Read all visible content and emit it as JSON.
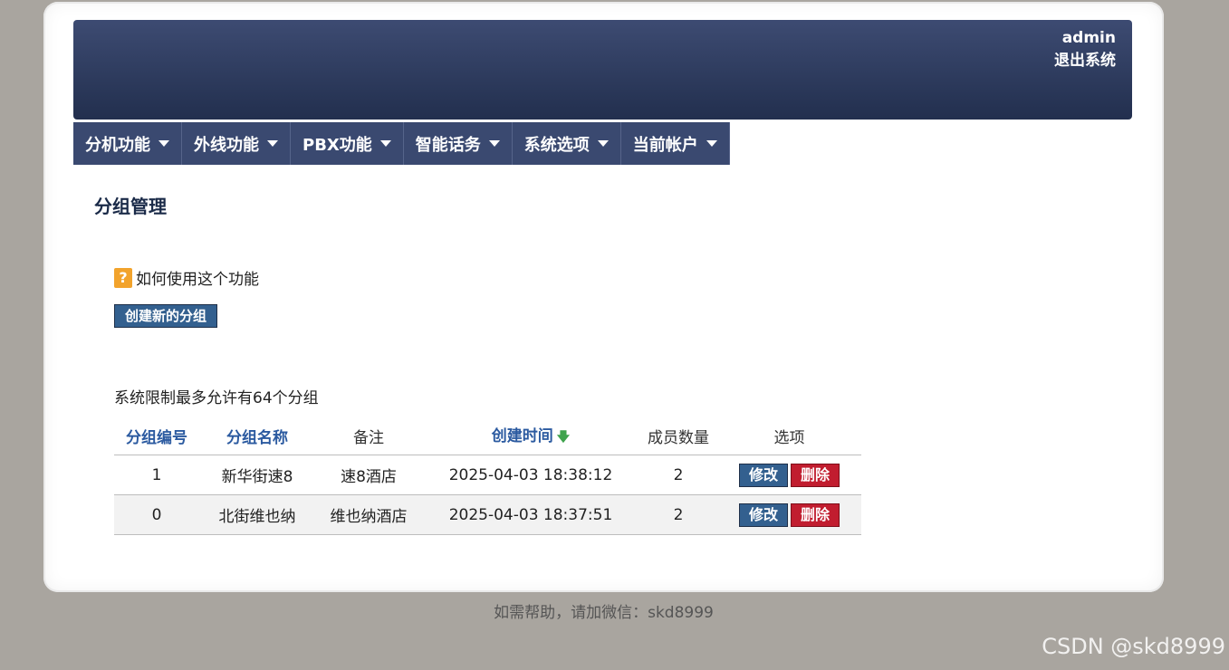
{
  "header": {
    "username": "admin",
    "logout_label": "退出系统"
  },
  "nav": {
    "items": [
      {
        "label": "分机功能"
      },
      {
        "label": "外线功能"
      },
      {
        "label": "PBX功能"
      },
      {
        "label": "智能话务"
      },
      {
        "label": "系统选项"
      },
      {
        "label": "当前帐户"
      }
    ]
  },
  "page": {
    "title": "分组管理",
    "help_icon": "?",
    "help_text": "如何使用这个功能",
    "create_label": "创建新的分组",
    "limit_text": "系统限制最多允许有64个分组"
  },
  "table": {
    "columns": [
      "分组编号",
      "分组名称",
      "备注",
      "创建时间",
      "成员数量",
      "选项"
    ],
    "sort_arrow": "🡇",
    "rows": [
      {
        "id": "1",
        "name": "新华街速8",
        "note": "速8酒店",
        "created": "2025-04-03 18:38:12",
        "members": "2"
      },
      {
        "id": "0",
        "name": "北街维也纳",
        "note": "维也纳酒店",
        "created": "2025-04-03 18:37:51",
        "members": "2"
      }
    ],
    "edit_label": "修改",
    "delete_label": "删除"
  },
  "footer": {
    "text": "如需帮助，请加微信：skd8999"
  },
  "watermark": "CSDN @skd8999",
  "colors": {
    "background": "#a9a59f",
    "header_top": "#3d4b72",
    "header_bottom": "#222f4e",
    "nav": "#3a4970",
    "edit_button": "#33608f",
    "delete_button": "#c11d2f",
    "link_blue": "#2b5aa0"
  }
}
